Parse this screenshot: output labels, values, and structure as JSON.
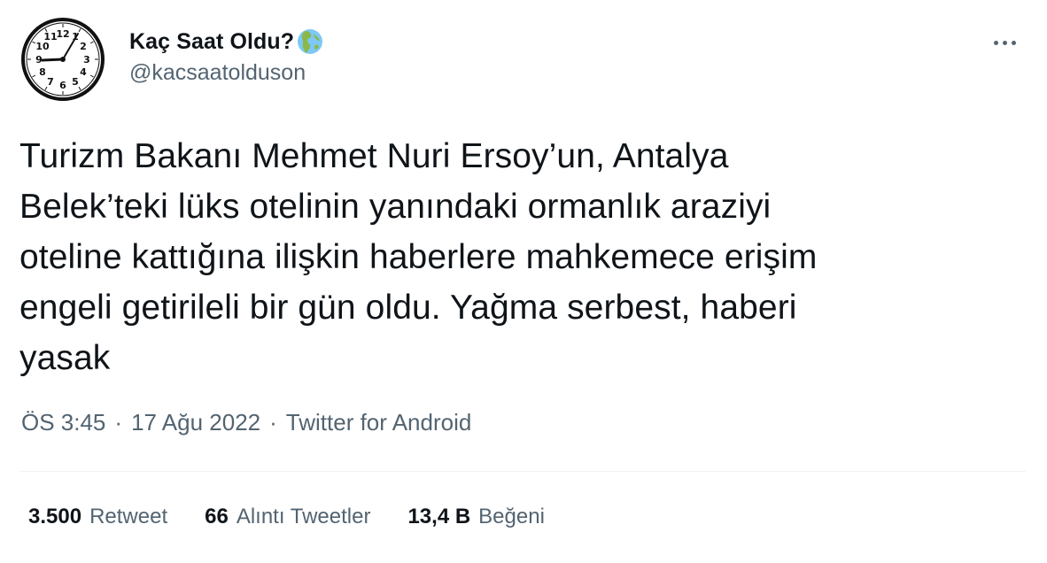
{
  "user": {
    "display_name": "Kaç Saat Oldu?",
    "handle": "@kacsaatolduson",
    "avatar_icon": "clock-icon",
    "badge_icon": "globe-africa-icon",
    "clock_numbers": [
      "12",
      "1",
      "2",
      "3",
      "4",
      "5",
      "6",
      "7",
      "8",
      "9",
      "10",
      "11"
    ]
  },
  "tweet": {
    "text": "Turizm Bakanı Mehmet Nuri Ersoy’un, Antalya\nBelek’teki lüks otelinin yanındaki ormanlık araziyi\noteline kattığına ilişkin haberlere mahkemece erişim\nengeli getirileli bir gün oldu. Yağma serbest, haberi\nyasak",
    "time": "ÖS 3:45",
    "date": "17 Ağu 2022",
    "source": "Twitter for Android",
    "separator": "·"
  },
  "stats": {
    "retweets": {
      "value": "3.500",
      "label": "Retweet"
    },
    "quotes": {
      "value": "66",
      "label": "Alıntı Tweetler"
    },
    "likes": {
      "value": "13,4 B",
      "label": "Beğeni"
    }
  },
  "colors": {
    "text_primary": "#0f1419",
    "text_secondary": "#536471",
    "divider": "#eff3f4"
  }
}
